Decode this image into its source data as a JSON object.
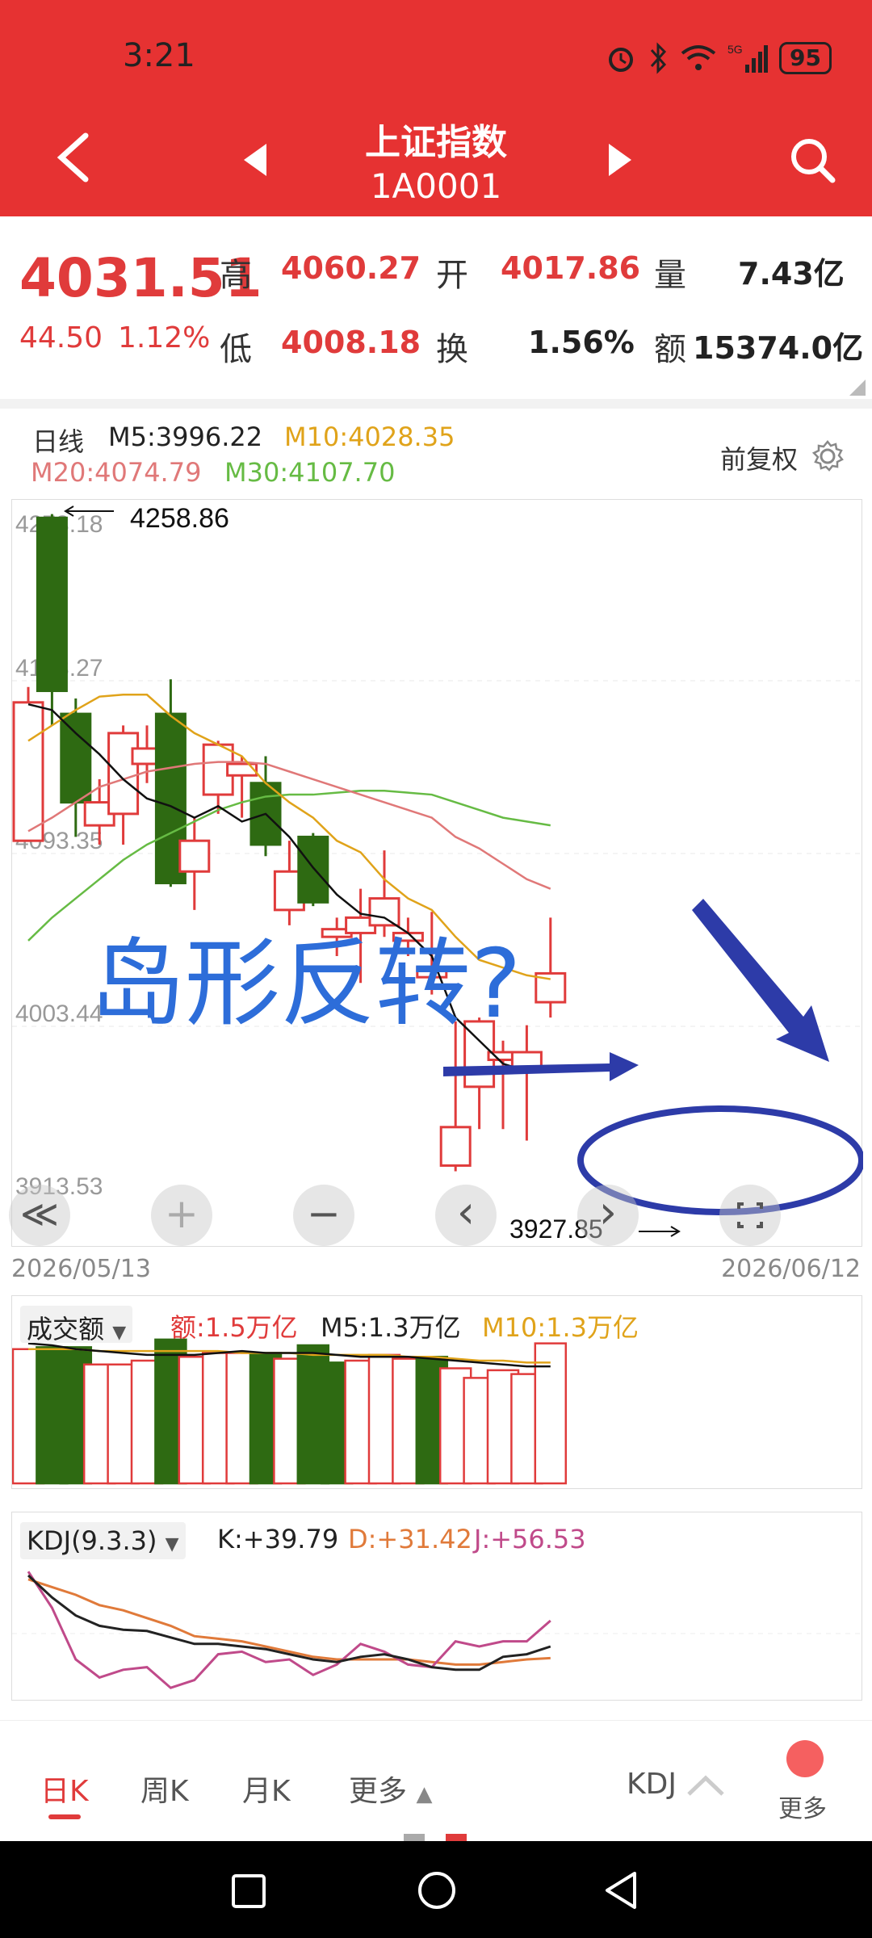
{
  "status": {
    "time": "3:21",
    "battery": "95"
  },
  "nav": {
    "title": "上证指数",
    "code": "1A0001"
  },
  "quote": {
    "price": "4031.51",
    "change": "44.50",
    "pct": "1.12%",
    "high_label": "高",
    "high": "4060.27",
    "low_label": "低",
    "low": "4008.18",
    "open_label": "开",
    "open": "4017.86",
    "turn_label": "换",
    "turn": "1.56%",
    "vol_label": "量",
    "vol": "7.43亿",
    "amt_label": "额",
    "amt": "15374.0亿"
  },
  "ma": {
    "period": "日线",
    "m5": "M5:3996.22",
    "m10": "M10:4028.35",
    "m20": "M20:4074.79",
    "m30": "M30:4107.70",
    "adjust": "前复权"
  },
  "chart": {
    "y_ticks": [
      "4273.18",
      "4183.27",
      "4093.35",
      "4003.44",
      "3913.53"
    ],
    "max_label": "4258.86",
    "min_label": "3927.85",
    "annotation": "岛形反转?",
    "date_start": "2026/05/13",
    "date_end": "2026/06/12"
  },
  "chart_data": {
    "type": "candlestick",
    "ylim": [
      3913.53,
      4273.18
    ],
    "candles": [
      {
        "o": 4100,
        "c": 4172,
        "h": 4180,
        "l": 4100
      },
      {
        "o": 4268,
        "c": 4178,
        "h": 4270,
        "l": 4160
      },
      {
        "o": 4166,
        "c": 4120,
        "h": 4174,
        "l": 4102
      },
      {
        "o": 4108,
        "c": 4120,
        "h": 4132,
        "l": 4098
      },
      {
        "o": 4114,
        "c": 4156,
        "h": 4160,
        "l": 4098
      },
      {
        "o": 4140,
        "c": 4148,
        "h": 4160,
        "l": 4130
      },
      {
        "o": 4166,
        "c": 4078,
        "h": 4184,
        "l": 4076
      },
      {
        "o": 4084,
        "c": 4100,
        "h": 4112,
        "l": 4064
      },
      {
        "o": 4124,
        "c": 4150,
        "h": 4152,
        "l": 4114
      },
      {
        "o": 4134,
        "c": 4140,
        "h": 4144,
        "l": 4112
      },
      {
        "o": 4130,
        "c": 4098,
        "h": 4144,
        "l": 4092
      },
      {
        "o": 4064,
        "c": 4084,
        "h": 4100,
        "l": 4056
      },
      {
        "o": 4102,
        "c": 4068,
        "h": 4104,
        "l": 4066
      },
      {
        "o": 4050,
        "c": 4054,
        "h": 4060,
        "l": 4040
      },
      {
        "o": 4052,
        "c": 4060,
        "h": 4075,
        "l": 4026
      },
      {
        "o": 4056,
        "c": 4070,
        "h": 4095,
        "l": 4050
      },
      {
        "o": 4048,
        "c": 4052,
        "h": 4060,
        "l": 4040
      },
      {
        "o": 4029,
        "c": 4034,
        "h": 4063,
        "l": 4020
      },
      {
        "o": 3931,
        "c": 3951,
        "h": 4006,
        "l": 3928
      },
      {
        "o": 3972,
        "c": 4006,
        "h": 4008,
        "l": 3950
      },
      {
        "o": 3986,
        "c": 3990,
        "h": 3996,
        "l": 3950
      },
      {
        "o": 3982,
        "c": 3990,
        "h": 4004,
        "l": 3944
      },
      {
        "o": 4016,
        "c": 4031,
        "h": 4060,
        "l": 4008
      }
    ],
    "ma5": [
      4171,
      4168,
      4156,
      4145,
      4132,
      4122,
      4118,
      4112,
      4118,
      4110,
      4114,
      4102,
      4086,
      4072,
      4062,
      4060,
      4052,
      4040,
      4008,
      3996,
      3984,
      3980,
      3981
    ],
    "ma10": [
      4152,
      4160,
      4168,
      4175,
      4176,
      4176,
      4165,
      4156,
      4150,
      4144,
      4130,
      4120,
      4112,
      4100,
      4094,
      4080,
      4070,
      4064,
      4050,
      4038,
      4034,
      4030,
      4028
    ],
    "ma20": [
      4105,
      4112,
      4120,
      4128,
      4132,
      4136,
      4138,
      4140,
      4141,
      4141,
      4140,
      4136,
      4132,
      4128,
      4124,
      4120,
      4116,
      4112,
      4102,
      4096,
      4088,
      4080,
      4075
    ],
    "ma30": [
      4048,
      4060,
      4070,
      4080,
      4090,
      4098,
      4104,
      4110,
      4116,
      4120,
      4123,
      4124,
      4124,
      4125,
      4126,
      4126,
      4125,
      4124,
      4120,
      4116,
      4112,
      4110,
      4108
    ],
    "volume_indicator": {
      "label": "成交额",
      "amount": "额:1.5万亿",
      "m5": "M5:1.3万亿",
      "m10": "M10:1.3万亿"
    },
    "volume": [
      1.4,
      1.42,
      1.42,
      1.24,
      1.24,
      1.28,
      1.5,
      1.32,
      1.36,
      1.36,
      1.36,
      1.3,
      1.44,
      1.26,
      1.28,
      1.34,
      1.3,
      1.32,
      1.2,
      1.1,
      1.18,
      1.14,
      1.46
    ],
    "volume_dir": [
      "u",
      "d",
      "d",
      "u",
      "u",
      "u",
      "d",
      "u",
      "u",
      "u",
      "d",
      "u",
      "d",
      "d",
      "u",
      "u",
      "u",
      "d",
      "u",
      "u",
      "u",
      "u",
      "u"
    ],
    "kdj": {
      "label": "KDJ(9.3.3)",
      "k_label": "K:+39.79",
      "d_label": "D:+31.42",
      "j_label": "J:+56.53",
      "k": [
        95,
        78,
        64,
        56,
        53,
        52,
        47,
        42,
        42,
        40,
        38,
        34,
        30,
        28,
        32,
        34,
        30,
        24,
        22,
        22,
        32,
        34,
        40
      ],
      "d": [
        92,
        86,
        80,
        72,
        68,
        62,
        56,
        48,
        46,
        44,
        40,
        36,
        32,
        30,
        30,
        30,
        30,
        28,
        26,
        26,
        28,
        30,
        31
      ],
      "j": [
        98,
        70,
        30,
        16,
        22,
        24,
        8,
        14,
        34,
        36,
        28,
        30,
        18,
        26,
        42,
        36,
        26,
        24,
        44,
        40,
        44,
        44,
        60
      ]
    }
  },
  "controls": {
    "rewind": "≪",
    "plus": "+",
    "minus": "−",
    "prev": "‹",
    "next": "›"
  },
  "tabs": [
    "日K",
    "周K",
    "月K",
    "更多"
  ],
  "indicator_tab": "KDJ",
  "more_label": "更多",
  "colors": {
    "up": "#e03b3b",
    "down": "#2e6a12",
    "ma5": "#111111",
    "ma10": "#e0a31a",
    "ma20": "#e07878",
    "ma30": "#66bb44",
    "annotation": "#2d6dd9",
    "arrow": "#2d3ba8"
  }
}
